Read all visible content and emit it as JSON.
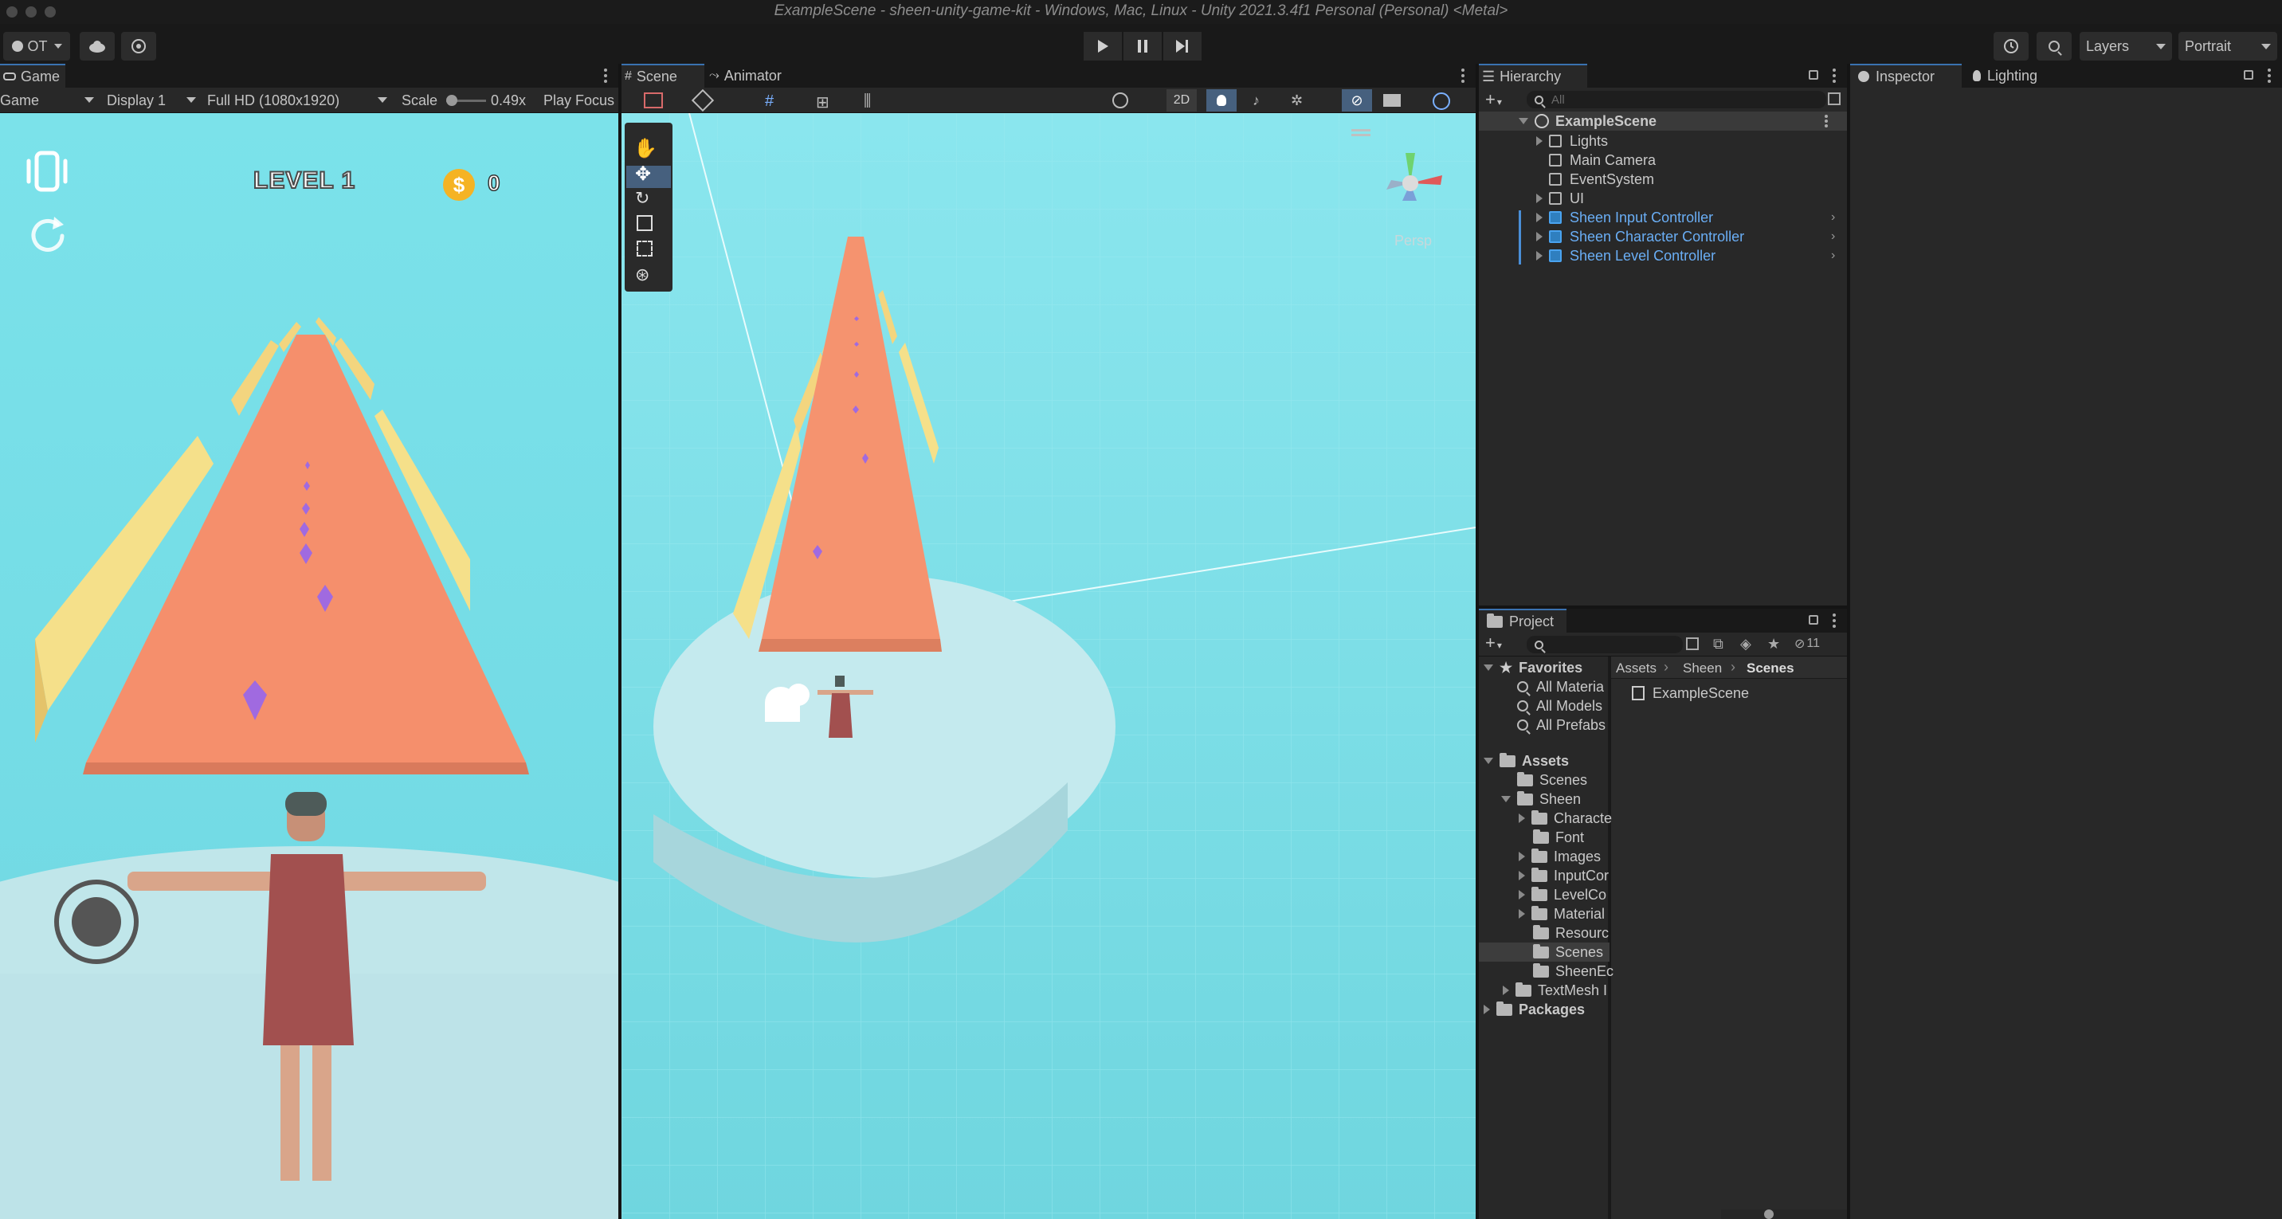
{
  "window": {
    "title": "ExampleScene - sheen-unity-game-kit - Windows, Mac, Linux - Unity 2021.3.4f1 Personal (Personal) <Metal>"
  },
  "toolbar": {
    "account_label": "OT",
    "layers_label": "Layers",
    "layout_label": "Portrait"
  },
  "game_panel": {
    "tab": "Game",
    "view_mode": "Game",
    "display": "Display 1",
    "resolution": "Full HD (1080x1920)",
    "scale_label": "Scale",
    "scale_value": "0.49x",
    "play_focus": "Play Focus",
    "hud_level": "LEVEL 1",
    "coin_symbol": "$",
    "coin_count": "0"
  },
  "scene_panel": {
    "tabs": [
      "Scene",
      "Animator"
    ],
    "mode_2d": "2D",
    "gizmo_label": "Persp"
  },
  "hierarchy": {
    "tab": "Hierarchy",
    "search_placeholder": "All",
    "scene": "ExampleScene",
    "items": [
      "Lights",
      "Main Camera",
      "EventSystem",
      "UI",
      "Sheen Input Controller",
      "Sheen Character Controller",
      "Sheen Level Controller"
    ]
  },
  "inspector": {
    "tabs": [
      "Inspector",
      "Lighting"
    ]
  },
  "project": {
    "tab": "Project",
    "hidden_count": "11",
    "breadcrumb": [
      "Assets",
      "Sheen",
      "Scenes"
    ],
    "favorites_label": "Favorites",
    "favorites": [
      "All Materia",
      "All Models",
      "All Prefabs"
    ],
    "assets_label": "Assets",
    "tree": [
      "Scenes",
      "Sheen",
      "Characte",
      "Font",
      "Images",
      "InputCor",
      "LevelCo",
      "Material",
      "Resourc",
      "Scenes",
      "SheenEc",
      "TextMesh I"
    ],
    "packages_label": "Packages",
    "files": [
      "ExampleScene"
    ]
  },
  "colors": {
    "accent": "#3a72b0",
    "sky": "#7fe1e8",
    "track": "#f58f6c",
    "rail": "#f5dd82",
    "link": "#6aaef5"
  }
}
